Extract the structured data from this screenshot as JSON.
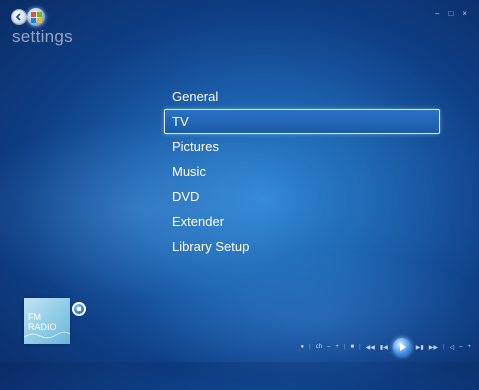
{
  "header": {
    "title": "settings"
  },
  "menu": {
    "items": [
      {
        "label": "General"
      },
      {
        "label": "TV"
      },
      {
        "label": "Pictures"
      },
      {
        "label": "Music"
      },
      {
        "label": "DVD"
      },
      {
        "label": "Extender"
      },
      {
        "label": "Library Setup"
      }
    ],
    "selected_index": 1
  },
  "fm_radio": {
    "line1": "FM",
    "line2": "RADIO"
  },
  "transport": {
    "channel_label": "ch"
  },
  "colors": {
    "background": "#1d62ae",
    "accent": "#3b8ee8"
  },
  "icons": [
    "back-arrow-icon",
    "windows-start-icon",
    "minimize-icon",
    "restore-icon",
    "close-icon",
    "stop-icon",
    "play-icon"
  ]
}
